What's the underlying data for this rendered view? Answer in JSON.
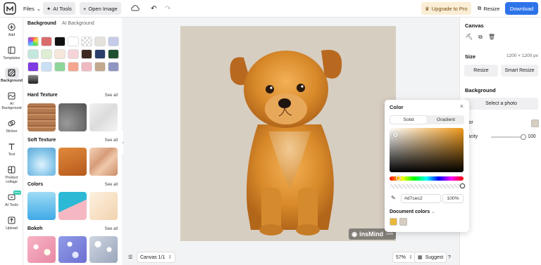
{
  "topbar": {
    "files_label": "Files",
    "ai_tools_label": "AI Tools",
    "open_image_label": "Open Image",
    "upgrade_label": "Upgrade to Pro",
    "resize_label": "Resize",
    "download_label": "Download"
  },
  "leftnav": {
    "items": [
      {
        "label": "Add",
        "icon": "plus-circle-icon"
      },
      {
        "label": "Templates",
        "icon": "templates-icon"
      },
      {
        "label": "Background",
        "icon": "background-icon"
      },
      {
        "label": "AI Background",
        "icon": "ai-background-icon"
      },
      {
        "label": "Sticker",
        "icon": "sticker-icon"
      },
      {
        "label": "Text",
        "icon": "text-icon"
      },
      {
        "label": "Product collage",
        "icon": "collage-icon"
      },
      {
        "label": "AI Tools",
        "icon": "ai-tools-icon"
      },
      {
        "label": "Upload",
        "icon": "upload-icon"
      }
    ],
    "new_badge": "New"
  },
  "panel": {
    "tab_background": "Background",
    "tab_ai_background": "AI Background",
    "swatches": [
      "#multi",
      "#d96b6b",
      "#111111",
      "#ffffff",
      "#transparent",
      "#e5e2dc",
      "#c5cbe8",
      "#c3e6dd",
      "#dfedd3",
      "#f7e7da",
      "#f5d3d8",
      "#3e2a20",
      "#2a3e6c",
      "#1f5130",
      "#7e3ae2",
      "#c9dff5",
      "#8fd59a",
      "#f6a68f",
      "#f0b8c0",
      "#c2a88d",
      "#8f96c0",
      "#555555"
    ],
    "hard_texture": "Hard Texture",
    "soft_texture": "Soft Texture",
    "colors": "Colors",
    "bokeh": "Bokeh",
    "see_all": "See all"
  },
  "canvas": {
    "bg_color": "#d7cec2",
    "watermark": "insMind",
    "watermark_sub": ".com"
  },
  "bottombar": {
    "canvas_label": "Canvas 1/1",
    "zoom": "57%",
    "suggest": "Suggest",
    "help": "?"
  },
  "rightpanel": {
    "title": "Canvas",
    "size_label": "Size",
    "size_value": "1200 × 1200 px",
    "resize_btn": "Resize",
    "smart_resize_btn": "Smart Resize",
    "background_label": "Background",
    "select_photo_btn": "Select a photo",
    "color_label": "olor",
    "opacity_label": "pacity",
    "opacity_value": "100"
  },
  "color_popup": {
    "title": "Color",
    "tab_solid": "Solid",
    "tab_gradient": "Gradient",
    "hex": "#d7cec2",
    "alpha": "100%",
    "document_colors": "Document colors",
    "doc_swatches": [
      "#e8b73b",
      "#d7cec2"
    ]
  }
}
